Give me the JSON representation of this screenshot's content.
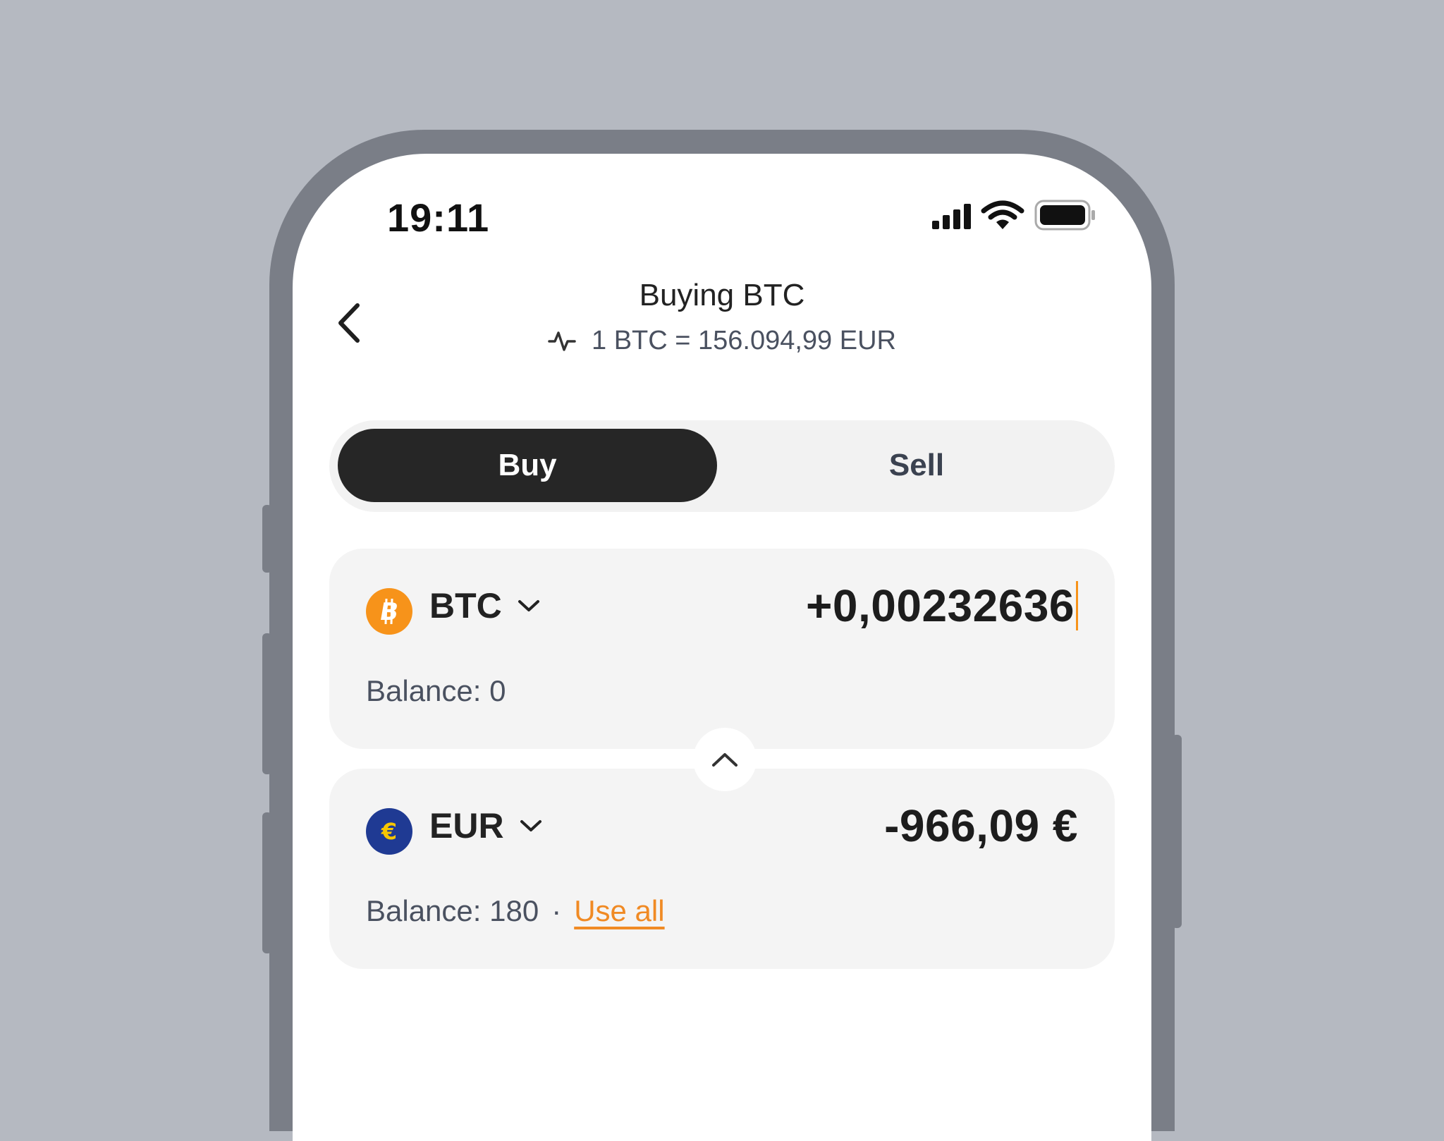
{
  "status_bar": {
    "time": "19:11"
  },
  "header": {
    "title": "Buying BTC",
    "rate": "1 BTC = 156.094,99 EUR"
  },
  "tabs": [
    {
      "label": "Buy",
      "active": true
    },
    {
      "label": "Sell",
      "active": false
    }
  ],
  "from_card": {
    "currency": "BTC",
    "amount": "+0,00232636",
    "balance": "Balance: 0",
    "icon": "bitcoin-icon",
    "icon_color": "#f7931a"
  },
  "to_card": {
    "currency": "EUR",
    "amount": "-966,09 €",
    "balance": "Balance: 180",
    "separator": "·",
    "use_all_label": "Use all",
    "icon": "euro-icon",
    "icon_color": "#1f3a93"
  },
  "colors": {
    "accent": "#f08a24",
    "active_tab": "#262626",
    "background": "#b5b9c1",
    "frame": "#7a7e87"
  }
}
